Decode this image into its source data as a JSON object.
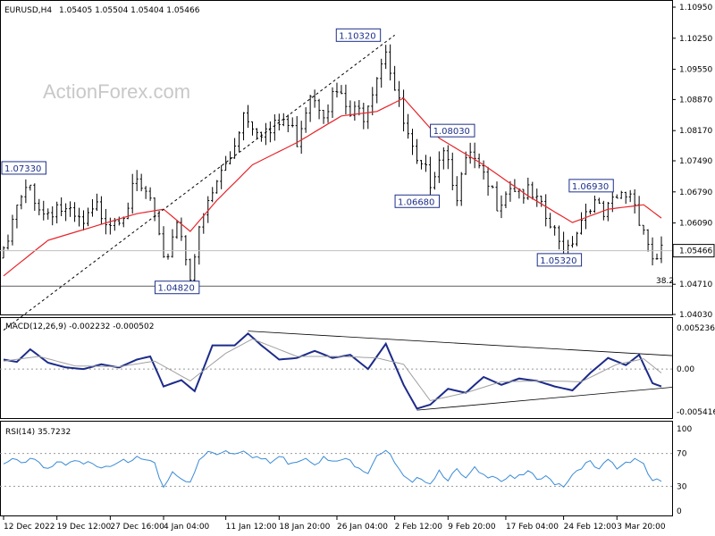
{
  "header": {
    "symbol": "EURUSD,H4",
    "ohlc": "1.05405 1.05504 1.05404 1.05466",
    "watermark": "ActionForex.com"
  },
  "colors": {
    "candles": "#000000",
    "ma": "#e8242a",
    "macd": "#1c2b8a",
    "signal": "#a0a0a0",
    "rsi": "#3b8bd6",
    "labels": "#1c2f8a",
    "trendline": "#000000"
  },
  "chart_data": [
    {
      "type": "candlestick",
      "panel": "price",
      "ylim": [
        1.0403,
        1.1095
      ],
      "yticks": [
        "1.10950",
        "1.10250",
        "1.09550",
        "1.08870",
        "1.08170",
        "1.07490",
        "1.06790",
        "1.06090",
        "1.05466",
        "1.04710",
        "1.04030"
      ],
      "last_price": "1.05466",
      "fib_level": {
        "label": "38.2",
        "value": 1.0467
      },
      "close_path": [
        [
          0,
          1.053
        ],
        [
          3,
          1.064
        ],
        [
          6,
          1.069
        ],
        [
          9,
          1.063
        ],
        [
          12,
          1.065
        ],
        [
          15,
          1.062
        ],
        [
          18,
          1.06
        ],
        [
          21,
          1.064
        ],
        [
          24,
          1.062
        ],
        [
          27,
          1.064
        ],
        [
          30,
          1.069
        ],
        [
          33,
          1.066
        ],
        [
          36,
          1.051
        ],
        [
          39,
          1.062
        ],
        [
          42,
          1.05
        ],
        [
          45,
          1.062
        ],
        [
          48,
          1.07
        ],
        [
          51,
          1.076
        ],
        [
          54,
          1.086
        ],
        [
          57,
          1.083
        ],
        [
          60,
          1.081
        ],
        [
          63,
          1.084
        ],
        [
          66,
          1.08
        ],
        [
          69,
          1.091
        ],
        [
          72,
          1.087
        ],
        [
          75,
          1.09
        ],
        [
          78,
          1.085
        ],
        [
          81,
          1.086
        ],
        [
          84,
          1.095
        ],
        [
          86,
          1.101
        ],
        [
          88,
          1.091
        ],
        [
          90,
          1.083
        ],
        [
          93,
          1.073
        ],
        [
          96,
          1.071
        ],
        [
          99,
          1.079
        ],
        [
          102,
          1.068
        ],
        [
          105,
          1.076
        ],
        [
          108,
          1.07
        ],
        [
          111,
          1.066
        ],
        [
          114,
          1.07
        ],
        [
          117,
          1.068
        ],
        [
          120,
          1.065
        ],
        [
          123,
          1.06
        ],
        [
          126,
          1.054
        ],
        [
          129,
          1.06
        ],
        [
          132,
          1.066
        ],
        [
          135,
          1.062
        ],
        [
          138,
          1.066
        ],
        [
          141,
          1.068
        ],
        [
          144,
          1.06
        ],
        [
          146,
          1.053
        ],
        [
          148,
          1.0547
        ]
      ],
      "ma_path": [
        [
          0,
          1.049
        ],
        [
          10,
          1.057
        ],
        [
          20,
          1.06
        ],
        [
          30,
          1.063
        ],
        [
          36,
          1.064
        ],
        [
          42,
          1.059
        ],
        [
          48,
          1.066
        ],
        [
          56,
          1.074
        ],
        [
          66,
          1.079
        ],
        [
          76,
          1.085
        ],
        [
          84,
          1.086
        ],
        [
          90,
          1.089
        ],
        [
          98,
          1.08
        ],
        [
          108,
          1.074
        ],
        [
          118,
          1.067
        ],
        [
          128,
          1.061
        ],
        [
          136,
          1.064
        ],
        [
          144,
          1.065
        ],
        [
          148,
          1.062
        ]
      ],
      "trendline": {
        "from": [
          0,
          1.0428
        ],
        "to": [
          88,
          1.1032
        ]
      },
      "annotations": [
        {
          "text": "1.10320",
          "x": 86,
          "y": 1.1032
        },
        {
          "text": "1.04820",
          "x": 42,
          "y": 1.0482
        },
        {
          "text": "1.06680",
          "x": 94,
          "y": 1.0668
        },
        {
          "text": "1.08030",
          "x": 101,
          "y": 1.0803
        },
        {
          "text": "1.05320",
          "x": 126,
          "y": 1.0532
        },
        {
          "text": "1.06930",
          "x": 138,
          "y": 1.0693
        },
        {
          "text": "1.07330",
          "x": 0,
          "y": 1.0733
        }
      ],
      "xlabels": [
        {
          "text": "12 Dec 2022",
          "x": 0
        },
        {
          "text": "19 Dec 12:00",
          "x": 12
        },
        {
          "text": "27 Dec 16:00",
          "x": 24
        },
        {
          "text": "4 Jan 04:00",
          "x": 36
        },
        {
          "text": "11 Jan 12:00",
          "x": 50
        },
        {
          "text": "18 Jan 20:00",
          "x": 62
        },
        {
          "text": "26 Jan 04:00",
          "x": 75
        },
        {
          "text": "2 Feb 12:00",
          "x": 88
        },
        {
          "text": "9 Feb 20:00",
          "x": 100
        },
        {
          "text": "17 Feb 04:00",
          "x": 113
        },
        {
          "text": "24 Feb 12:00",
          "x": 126
        },
        {
          "text": "3 Mar 20:00",
          "x": 138
        }
      ]
    },
    {
      "type": "line",
      "panel": "macd",
      "title": "MACD(12,26,9) -0.002232 -0.000502",
      "ylim": [
        -0.0062,
        0.006
      ],
      "yticks": [
        "0.005236",
        "0.00",
        "-0.005416"
      ],
      "series": [
        {
          "name": "MACD",
          "values": [
            [
              0,
              0.0012
            ],
            [
              3,
              0.0009
            ],
            [
              6,
              0.0025
            ],
            [
              10,
              0.0008
            ],
            [
              14,
              0.0002
            ],
            [
              18,
              0.0
            ],
            [
              22,
              0.0006
            ],
            [
              26,
              0.0002
            ],
            [
              30,
              0.0012
            ],
            [
              33,
              0.0016
            ],
            [
              36,
              -0.0022
            ],
            [
              40,
              -0.0014
            ],
            [
              43,
              -0.0028
            ],
            [
              47,
              0.003
            ],
            [
              52,
              0.003
            ],
            [
              55,
              0.0045
            ],
            [
              58,
              0.003
            ],
            [
              62,
              0.0012
            ],
            [
              66,
              0.0014
            ],
            [
              70,
              0.0023
            ],
            [
              74,
              0.0014
            ],
            [
              78,
              0.0018
            ],
            [
              82,
              0.0
            ],
            [
              86,
              0.0032
            ],
            [
              90,
              -0.002
            ],
            [
              93,
              -0.005
            ],
            [
              96,
              -0.0045
            ],
            [
              100,
              -0.0025
            ],
            [
              104,
              -0.003
            ],
            [
              108,
              -0.001
            ],
            [
              112,
              -0.002
            ],
            [
              116,
              -0.0012
            ],
            [
              120,
              -0.0015
            ],
            [
              124,
              -0.0022
            ],
            [
              128,
              -0.0027
            ],
            [
              132,
              -0.0005
            ],
            [
              136,
              0.0014
            ],
            [
              140,
              0.0005
            ],
            [
              143,
              0.0018
            ],
            [
              146,
              -0.0018
            ],
            [
              148,
              -0.0022
            ]
          ]
        },
        {
          "name": "Signal",
          "values": [
            [
              0,
              0.001
            ],
            [
              8,
              0.0016
            ],
            [
              16,
              0.0004
            ],
            [
              26,
              0.0003
            ],
            [
              34,
              0.001
            ],
            [
              42,
              -0.0015
            ],
            [
              50,
              0.002
            ],
            [
              56,
              0.0038
            ],
            [
              66,
              0.0016
            ],
            [
              76,
              0.0016
            ],
            [
              84,
              0.0014
            ],
            [
              90,
              0.0006
            ],
            [
              96,
              -0.004
            ],
            [
              104,
              -0.003
            ],
            [
              112,
              -0.0016
            ],
            [
              122,
              -0.0015
            ],
            [
              130,
              -0.0016
            ],
            [
              138,
              0.0006
            ],
            [
              144,
              0.0013
            ],
            [
              148,
              -0.0005
            ]
          ]
        }
      ],
      "trendlines": [
        {
          "from": [
            55,
            0.0048
          ],
          "to": [
            148,
            0.0017
          ]
        },
        {
          "from": [
            93,
            -0.0052
          ],
          "to": [
            148,
            -0.0023
          ]
        }
      ]
    },
    {
      "type": "line",
      "panel": "rsi",
      "title": "RSI(14) 35.7232",
      "ylim": [
        0,
        100
      ],
      "yticks": [
        "100",
        "70",
        "30",
        "0"
      ],
      "levels": [
        70,
        30
      ],
      "series": [
        {
          "name": "RSI",
          "values": [
            [
              0,
              55
            ],
            [
              2,
              62
            ],
            [
              4,
              58
            ],
            [
              6,
              66
            ],
            [
              8,
              60
            ],
            [
              10,
              52
            ],
            [
              12,
              58
            ],
            [
              14,
              54
            ],
            [
              16,
              60
            ],
            [
              18,
              55
            ],
            [
              20,
              60
            ],
            [
              22,
              55
            ],
            [
              24,
              58
            ],
            [
              26,
              62
            ],
            [
              28,
              56
            ],
            [
              30,
              65
            ],
            [
              32,
              60
            ],
            [
              34,
              55
            ],
            [
              36,
              30
            ],
            [
              38,
              48
            ],
            [
              40,
              42
            ],
            [
              42,
              32
            ],
            [
              44,
              60
            ],
            [
              46,
              72
            ],
            [
              48,
              68
            ],
            [
              50,
              75
            ],
            [
              52,
              70
            ],
            [
              54,
              76
            ],
            [
              56,
              68
            ],
            [
              58,
              63
            ],
            [
              60,
              58
            ],
            [
              62,
              66
            ],
            [
              64,
              60
            ],
            [
              66,
              62
            ],
            [
              68,
              66
            ],
            [
              70,
              60
            ],
            [
              72,
              64
            ],
            [
              74,
              58
            ],
            [
              76,
              62
            ],
            [
              78,
              60
            ],
            [
              80,
              55
            ],
            [
              82,
              48
            ],
            [
              84,
              70
            ],
            [
              86,
              74
            ],
            [
              88,
              58
            ],
            [
              90,
              40
            ],
            [
              92,
              32
            ],
            [
              94,
              42
            ],
            [
              96,
              35
            ],
            [
              98,
              50
            ],
            [
              100,
              40
            ],
            [
              102,
              48
            ],
            [
              104,
              38
            ],
            [
              106,
              50
            ],
            [
              108,
              42
            ],
            [
              110,
              46
            ],
            [
              112,
              38
            ],
            [
              114,
              44
            ],
            [
              116,
              40
            ],
            [
              118,
              46
            ],
            [
              120,
              38
            ],
            [
              122,
              40
            ],
            [
              124,
              35
            ],
            [
              126,
              32
            ],
            [
              128,
              45
            ],
            [
              130,
              55
            ],
            [
              132,
              58
            ],
            [
              134,
              48
            ],
            [
              136,
              62
            ],
            [
              138,
              52
            ],
            [
              140,
              60
            ],
            [
              142,
              65
            ],
            [
              144,
              58
            ],
            [
              146,
              35
            ],
            [
              148,
              36
            ]
          ]
        }
      ]
    }
  ]
}
